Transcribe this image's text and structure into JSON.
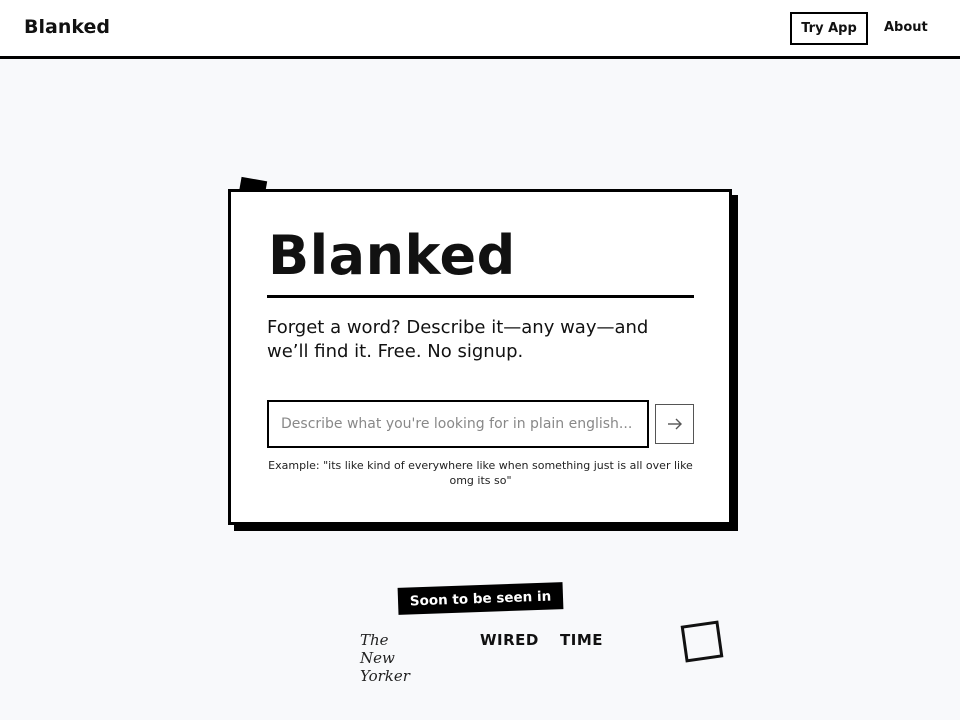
{
  "nav": {
    "brand": "Blanked",
    "try_app_label": "Try App",
    "about_label": "About"
  },
  "hero": {
    "title": "Blanked",
    "tagline": "Forget a word? Describe it—any way—and we’ll find it. Free. No signup.",
    "search": {
      "placeholder": "Describe what you're looking for in plain english...",
      "value": "",
      "submit_icon": "arrow-right-icon"
    },
    "example": "Example: \"its like kind of everywhere like when something just is all over like omg its so\""
  },
  "press": {
    "badge": "Soon to be seen in",
    "logos": [
      "The New Yorker",
      "WIRED",
      "TIME"
    ]
  },
  "colors": {
    "background": "#f8f9fb",
    "ink": "#000000",
    "surface": "#ffffff"
  }
}
